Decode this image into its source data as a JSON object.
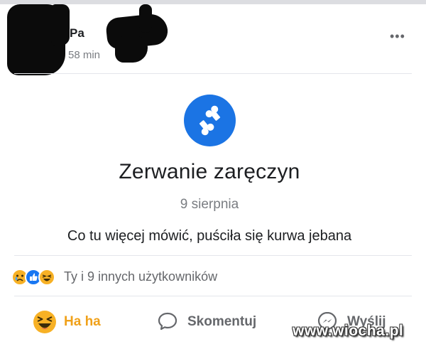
{
  "post": {
    "author_visible": "Pa",
    "time_ago": "58 min",
    "more_label": "•••"
  },
  "event": {
    "icon": "broken-heart-bone-icon",
    "title": "Zerwanie zaręczyn",
    "date": "9 sierpnia",
    "message": "Co tu więcej mówić, puściła się kurwa jebana"
  },
  "reactions": {
    "icons": [
      "sad-reaction-icon",
      "like-reaction-icon",
      "haha-reaction-icon"
    ],
    "summary": "Ty i 9 innych użytkowników"
  },
  "actions": {
    "haha_label": "Ha ha",
    "comment_label": "Skomentuj",
    "send_label": "Wyślij"
  },
  "watermark": "www.wiocha.pl",
  "colors": {
    "accent_blue": "#1b74e4",
    "haha_yellow": "#f0a11a",
    "text_gray": "#65676b"
  }
}
